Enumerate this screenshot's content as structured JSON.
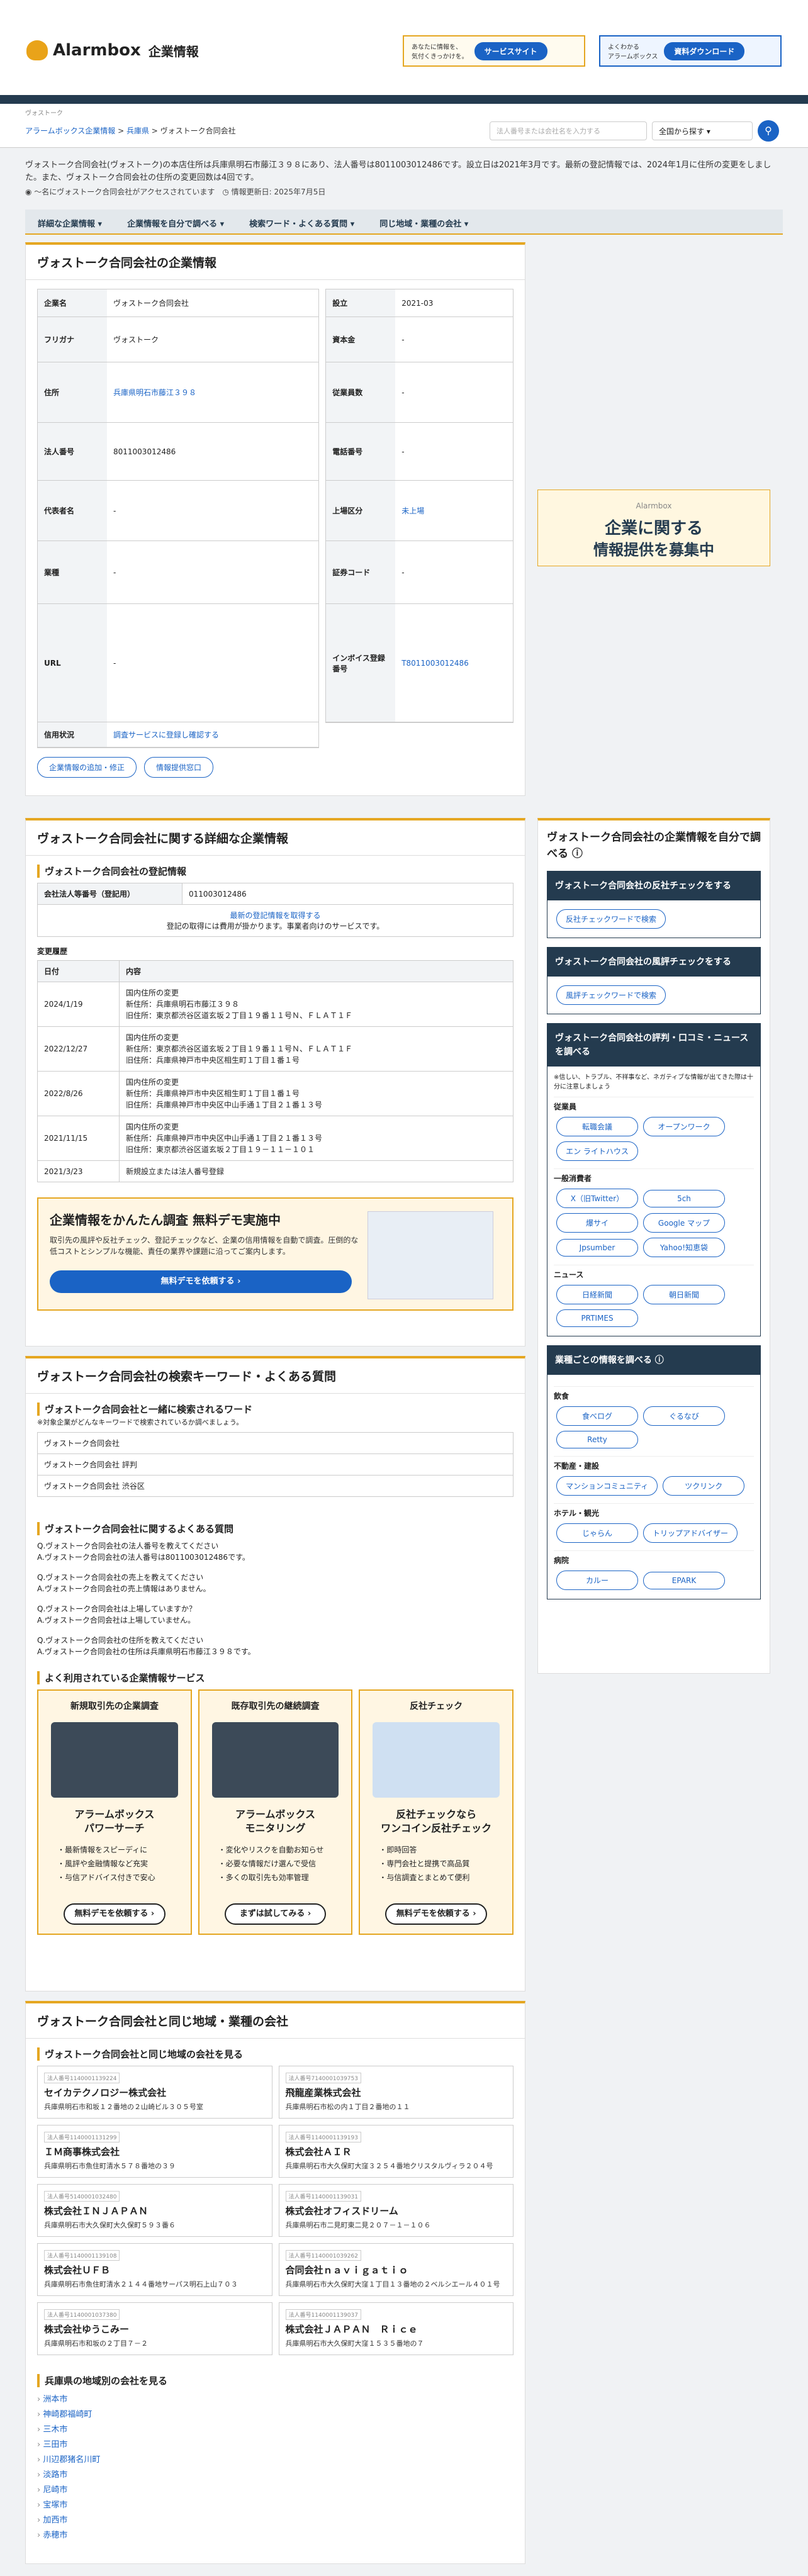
{
  "header": {
    "logo": "Alarmbox",
    "logo_sub": "企業情報",
    "btn1_small": "あなたに情報を、\n気付くきっかけを。",
    "btn1": "サービスサイト",
    "btn2_small": "よくわかる\nアラームボックス",
    "btn2": "資料ダウンロード"
  },
  "crumb": {
    "tag": "ヴォストーク",
    "items": [
      "アラームボックス企業情報",
      "兵庫県",
      "ヴォストーク合同会社"
    ],
    "search_placeholder": "法人番号または会社名を入力する",
    "select": "全国から探す"
  },
  "summary": {
    "text": "ヴォストーク合同会社(ヴォストーク)の本店住所は兵庫県明石市藤江３９８にあり、法人番号は8011003012486です。設立日は2021年3月です。最新の登記情報では、2024年1月に住所の変更をしました。また、ヴォストーク合同会社の住所の変更回数は4回です。",
    "views": "〜名にヴォストーク合同会社がアクセスされています",
    "updated": "情報更新日: 2025年7月5日"
  },
  "tabs": [
    "詳細な企業情報",
    "企業情報を自分で調べる",
    "検索ワード・よくある質問",
    "同じ地域・業種の会社"
  ],
  "profile": {
    "title": "ヴォストーク合同会社の企業情報",
    "left": [
      {
        "k": "企業名",
        "v": "ヴォストーク合同会社"
      },
      {
        "k": "フリガナ",
        "v": "ヴォストーク"
      },
      {
        "k": "住所",
        "v": "兵庫県明石市藤江３９８"
      },
      {
        "k": "法人番号",
        "v": "8011003012486"
      },
      {
        "k": "代表者名",
        "v": "-"
      },
      {
        "k": "業種",
        "v": "-"
      },
      {
        "k": "URL",
        "v": "-"
      },
      {
        "k": "信用状況",
        "v": "調査サービスに登録し確認する"
      }
    ],
    "right": [
      {
        "k": "設立",
        "v": "2021-03"
      },
      {
        "k": "資本金",
        "v": "-"
      },
      {
        "k": "従業員数",
        "v": "-"
      },
      {
        "k": "電話番号",
        "v": "-"
      },
      {
        "k": "上場区分",
        "v": "未上場"
      },
      {
        "k": "証券コード",
        "v": "-"
      },
      {
        "k": "インボイス登録番号",
        "v": "T8011003012486"
      }
    ],
    "btn_add": "企業情報の追加・修正",
    "btn_info": "情報提供窓口"
  },
  "detail": {
    "title": "ヴォストーク合同会社に関する詳細な企業情報",
    "reg_title": "ヴォストーク合同会社の登記情報",
    "reg_label": "会社法人等番号（登記用）",
    "reg_value": "011003012486",
    "reg_link": "最新の登記情報を取得する",
    "reg_note": "登記の取得には費用が掛かります。事業者向けのサービスです。",
    "hist_title": "変更履歴",
    "hist_h": [
      "日付",
      "内容"
    ],
    "hist": [
      {
        "d": "2024/1/19",
        "c": "国内住所の変更\n新住所：兵庫県明石市藤江３９８\n旧住所：東京都渋谷区道玄坂２丁目１９番１１号Ｎ、ＦＬＡＴ１Ｆ"
      },
      {
        "d": "2022/12/27",
        "c": "国内住所の変更\n新住所：東京都渋谷区道玄坂２丁目１９番１１号Ｎ、ＦＬＡＴ１Ｆ\n旧住所：兵庫県神戸市中央区相生町１丁目１番１号"
      },
      {
        "d": "2022/8/26",
        "c": "国内住所の変更\n新住所：兵庫県神戸市中央区相生町１丁目１番１号\n旧住所：兵庫県神戸市中央区中山手通１丁目２１番１３号"
      },
      {
        "d": "2021/11/15",
        "c": "国内住所の変更\n新住所：兵庫県神戸市中央区中山手通１丁目２１番１３号\n旧住所：東京都渋谷区道玄坂２丁目１９－１１－１０１"
      },
      {
        "d": "2021/3/23",
        "c": "新規設立または法人番号登録"
      }
    ],
    "demo_title": "企業情報をかんたん調査 無料デモ実施中",
    "demo_text": "取引先の風評や反社チェック、登記チェックなど、企業の信用情報を自動で調査。圧倒的な低コストとシンプルな機能、責任の業界や課題に沿ってご案内します。",
    "demo_btn": "無料デモを依頼する"
  },
  "faq": {
    "title": "ヴォストーク合同会社の検索キーワード・よくある質問",
    "kw_title": "ヴォストーク合同会社と一緒に検索されるワード",
    "kw_note": "※対象企業がどんなキーワードで検索されているか調べましょう。",
    "kws": [
      "ヴォストーク合同会社",
      "ヴォストーク合同会社 評判",
      "ヴォストーク合同会社 渋谷区"
    ],
    "qa_title": "ヴォストーク合同会社に関するよくある質問",
    "qa": [
      "Q.ヴォストーク合同会社の法人番号を教えてください\nA.ヴォストーク合同会社の法人番号は8011003012486です。",
      "Q.ヴォストーク合同会社の売上を教えてください\nA.ヴォストーク合同会社の売上情報はありません。",
      "Q.ヴォストーク合同会社は上場していますか？\nA.ヴォストーク合同会社は上場していません。",
      "Q.ヴォストーク合同会社の住所を教えてください\nA.ヴォストーク合同会社の住所は兵庫県明石市藤江３９８です。"
    ],
    "svc_title": "よく利用されている企業情報サービス",
    "svcs": [
      {
        "t": "新規取引先の企業調査",
        "n": "アラームボックス\nパワーサーチ",
        "l": [
          "・最新情報をスピーディに",
          "・風評や金融情報など充実",
          "・与信アドバイス付きで安心"
        ],
        "b": "無料デモを依頼する"
      },
      {
        "t": "既存取引先の継続調査",
        "n": "アラームボックス\nモニタリング",
        "l": [
          "・変化やリスクを自動お知らせ",
          "・必要な情報だけ選んで受信",
          "・多くの取引先も効率管理"
        ],
        "b": "まずは試してみる"
      },
      {
        "t": "反社チェック",
        "n": "反社チェックなら\nワンコイン反社チェック",
        "l": [
          "・即時回答",
          "・専門会社と提携で高品質",
          "・与信調査とまとめて便利"
        ],
        "b": "無料デモを依頼する"
      }
    ]
  },
  "region": {
    "title": "ヴォストーク合同会社と同じ地域・業種の会社",
    "near_title": "ヴォストーク合同会社と同じ地域の会社を見る",
    "cos": [
      {
        "no": "法人番号1140001139224",
        "n": "セイカテクノロジー株式会社",
        "a": "兵庫県明石市和坂１２番地の２山崎ビル３０５号室"
      },
      {
        "no": "法人番号7140001039753",
        "n": "飛龍産業株式会社",
        "a": "兵庫県明石市松の内１丁目２番地の１１"
      },
      {
        "no": "法人番号1140001131299",
        "n": "ＩＭ商事株式会社",
        "a": "兵庫県明石市魚住町清水５７８番地の３９"
      },
      {
        "no": "法人番号1140001139193",
        "n": "株式会社ＡＩＲ",
        "a": "兵庫県明石市大久保町大窪３２５４番地クリスタルヴィラ２０４号"
      },
      {
        "no": "法人番号5140001032480",
        "n": "株式会社ＩＮＪＡＰＡＮ",
        "a": "兵庫県明石市大久保町大久保町５９３番６"
      },
      {
        "no": "法人番号1140001139031",
        "n": "株式会社オフィスドリーム",
        "a": "兵庫県明石市二見町東二見２０７－１－１０６"
      },
      {
        "no": "法人番号1140001139108",
        "n": "株式会社ＵＦＢ",
        "a": "兵庫県明石市魚住町清水２１４４番地サーパス明石上山７０３"
      },
      {
        "no": "法人番号1140001039262",
        "n": "合同会社ｎａｖｉｇａｔｉｏ",
        "a": "兵庫県明石市大久保町大窪１丁目１３番地の２ベルシエール４０１号"
      },
      {
        "no": "法人番号1140001037380",
        "n": "株式会社ゆうこみー",
        "a": "兵庫県明石市和坂の２丁目７－２"
      },
      {
        "no": "法人番号1140001139037",
        "n": "株式会社ＪＡＰＡＮ　Ｒｉｃｅ",
        "a": "兵庫県明石市大久保町大窪１５３５番地の７"
      }
    ],
    "area_title": "兵庫県の地域別の会社を見る",
    "areas": [
      "洲本市",
      "神崎郡福崎町",
      "三木市",
      "三田市",
      "川辺郡猪名川町",
      "淡路市",
      "尼崎市",
      "宝塚市",
      "加西市",
      "赤穂市"
    ]
  },
  "side": {
    "ad_l1": "企業に関する",
    "ad_l2": "情報提供を募集中",
    "title": "ヴォストーク合同会社の企業情報を自分で調べる",
    "b1": "ヴォストーク合同会社の反社チェックをする",
    "b1btn": "反社チェックワードで検索",
    "b2": "ヴォストーク合同会社の風評チェックをする",
    "b2btn": "風評チェックワードで検索",
    "b3": "ヴォストーク合同会社の評判・口コミ・ニュースを調べる",
    "b3note": "※信しい、トラブル、不祥事など、ネガティブな情報が出てきた際は十分に注意しましょう",
    "g1": "従業員",
    "g1i": [
      "転職会議",
      "オープンワーク",
      "エン ライトハウス"
    ],
    "g2": "一般消費者",
    "g2i": [
      "X（旧Twitter）",
      "5ch",
      "爆サイ",
      "Google マップ",
      "Jpsumber",
      "Yahoo!知恵袋"
    ],
    "g3": "ニュース",
    "g3i": [
      "日経新聞",
      "朝日新聞",
      "PRTIMES"
    ],
    "t2": "業種ごとの情報を調べる",
    "h1": "飲食",
    "h1i": [
      "食べログ",
      "ぐるなび",
      "Retty"
    ],
    "h2": "不動産・建設",
    "h2i": [
      "マンションコミュニティ",
      "ツクリンク"
    ],
    "h3": "ホテル・観光",
    "h3i": [
      "じゃらん",
      "トリップアドバイザー"
    ],
    "h4": "病院",
    "h4i": [
      "カルー",
      "EPARK"
    ]
  }
}
